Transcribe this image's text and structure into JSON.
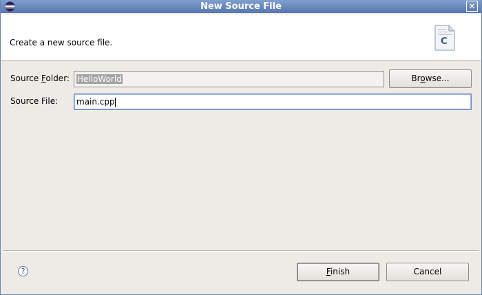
{
  "window": {
    "title": "New Source File"
  },
  "banner": {
    "message": "Create a new source file.",
    "icon_letter": "C"
  },
  "form": {
    "source_folder_label_pre": "Source ",
    "source_folder_label_mnemonic": "F",
    "source_folder_label_post": "older:",
    "source_folder_value": "HelloWorld",
    "browse_label_pre": "Br",
    "browse_label_mnemonic": "o",
    "browse_label_post": "wse...",
    "source_file_label": "Source File:",
    "source_file_value": "main.cpp"
  },
  "footer": {
    "help_glyph": "?",
    "finish_label_mnemonic": "F",
    "finish_label_post": "inish",
    "cancel_label": "Cancel"
  }
}
